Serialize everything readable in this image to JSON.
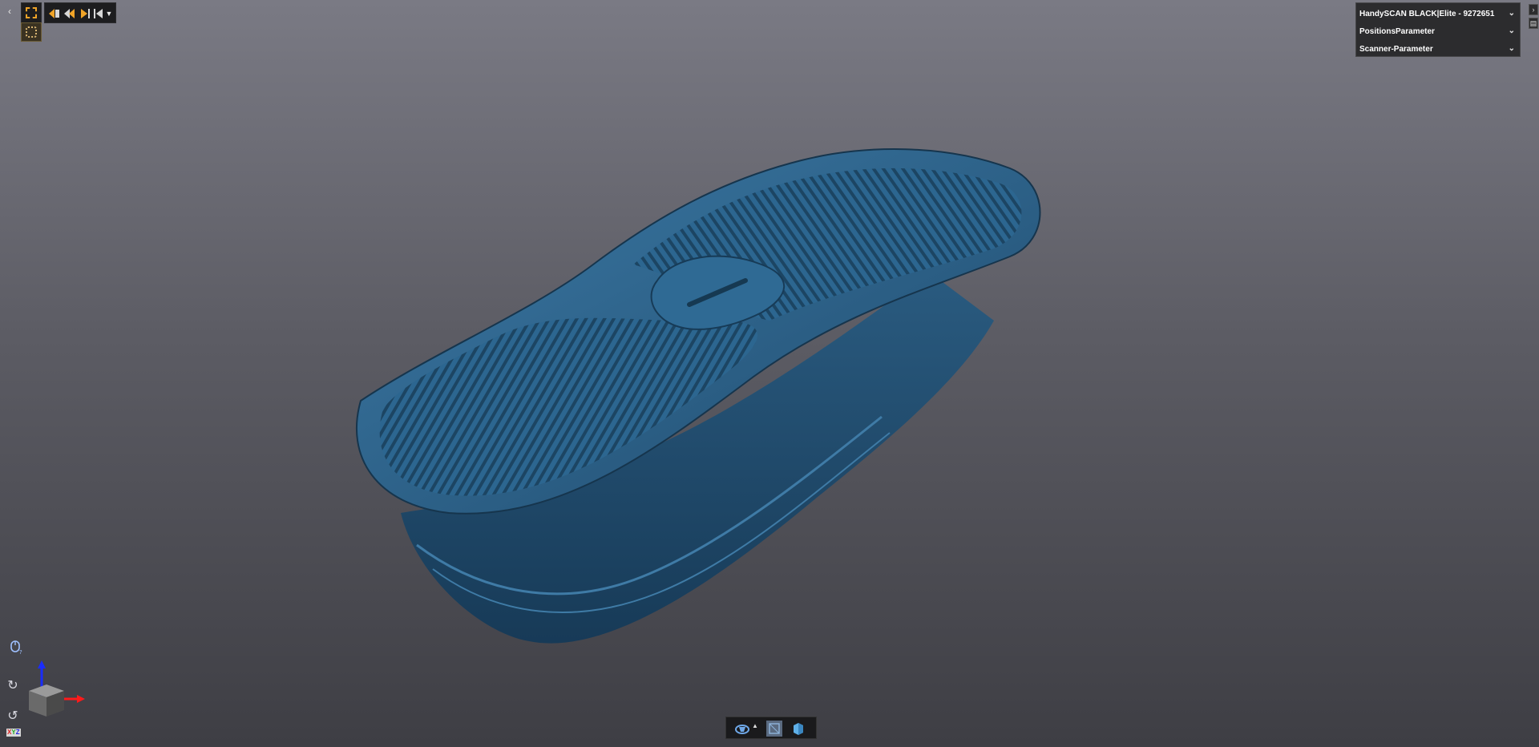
{
  "viewport": {
    "background_top": "#7a7a84",
    "background_bottom": "#3e3e44",
    "model_color": "#2d5f86"
  },
  "toolbar": {
    "collapse_icon": "chevron-left-icon",
    "selection_icon": "rectangle-select-icon",
    "selection2_icon": "lasso-select-icon",
    "view_icons": [
      "view-front-icon",
      "view-back-icon",
      "view-next-icon",
      "view-last-icon"
    ],
    "dropdown_icon": "chevron-down-icon",
    "accent": "#f0a428"
  },
  "panel": {
    "rows": [
      {
        "label": "HandySCAN BLACK|Elite - 9272651"
      },
      {
        "label": "PositionsParameter"
      },
      {
        "label": "Scanner-Parameter"
      }
    ]
  },
  "left_controls": {
    "mouse_icon": "mouse-help-icon",
    "rotate_cw_icon": "rotate-cw-icon",
    "rotate_ccw_icon": "rotate-ccw-icon",
    "xyz": {
      "x": "X",
      "y": "Y",
      "z": "Z"
    }
  },
  "bottom_bar": {
    "items": [
      "render-mode-icon",
      "wireframe-icon",
      "solid-view-icon"
    ]
  }
}
